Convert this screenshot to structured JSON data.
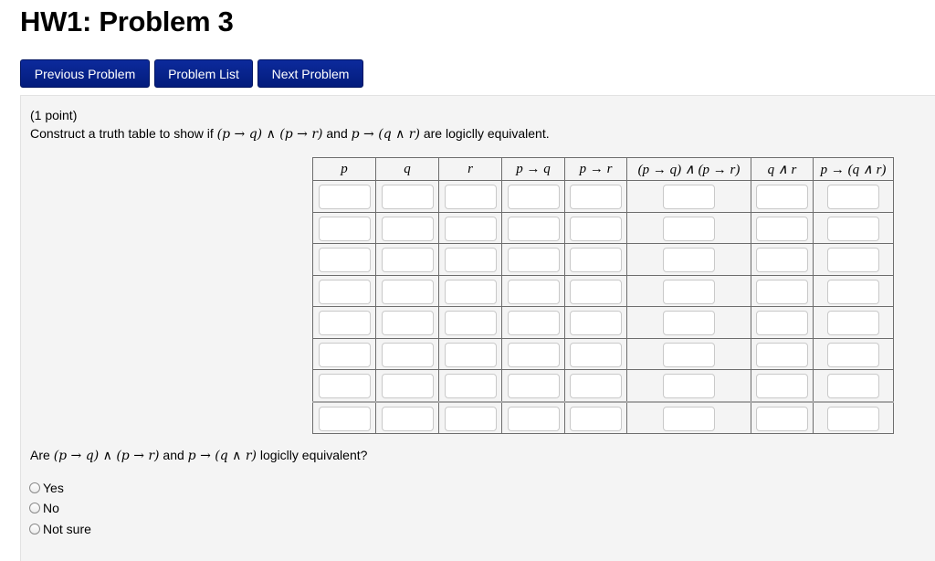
{
  "page": {
    "title": "HW1: Problem 3"
  },
  "nav": {
    "previous": "Previous Problem",
    "list": "Problem List",
    "next": "Next Problem"
  },
  "problem": {
    "points": "(1 point)",
    "prompt_prefix": "Construct a truth table to show if",
    "expr1": "(p → q) ∧ (p → r)",
    "and": "and",
    "expr2": "p → (q ∧ r)",
    "prompt_suffix": "are logiclly equivalent."
  },
  "truth_table": {
    "headers": [
      "p",
      "q",
      "r",
      "p → q",
      "p → r",
      "(p → q) ∧ (p → r)",
      "q ∧ r",
      "p → (q ∧ r)"
    ],
    "rows": [
      [
        "",
        "",
        "",
        "",
        "",
        "",
        "",
        ""
      ],
      [
        "",
        "",
        "",
        "",
        "",
        "",
        "",
        ""
      ],
      [
        "",
        "",
        "",
        "",
        "",
        "",
        "",
        ""
      ],
      [
        "",
        "",
        "",
        "",
        "",
        "",
        "",
        ""
      ],
      [
        "",
        "",
        "",
        "",
        "",
        "",
        "",
        ""
      ],
      [
        "",
        "",
        "",
        "",
        "",
        "",
        "",
        ""
      ],
      [
        "",
        "",
        "",
        "",
        "",
        "",
        "",
        ""
      ],
      [
        "",
        "",
        "",
        "",
        "",
        "",
        "",
        ""
      ]
    ]
  },
  "question": {
    "prefix": "Are",
    "expr1": "(p → q) ∧ (p → r)",
    "and": "and",
    "expr2": "p → (q ∧ r)",
    "suffix": "logiclly equivalent?",
    "options": [
      "Yes",
      "No",
      "Not sure"
    ],
    "selected": null
  }
}
